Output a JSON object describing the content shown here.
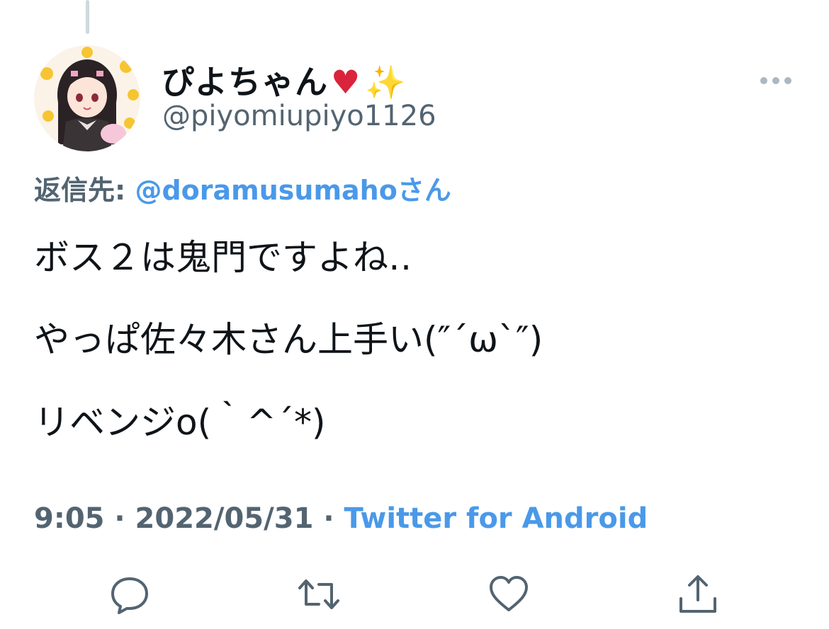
{
  "tweet": {
    "display_name": "ぴよちゃん",
    "name_emoji_heart": "♥",
    "name_emoji_sparkles": "✨",
    "handle": "@piyomiupiyo1126",
    "reply_prefix": "返信先: ",
    "reply_to": "@doramusumahoさん",
    "text_lines": [
      "ボス２は鬼門ですよね‥",
      "やっぱ佐々木さん上手い(″´ω`″)",
      "リベンジo(｀^´*)"
    ],
    "time": "9:05 · 2022/05/31 · ",
    "source": "Twitter for Android"
  },
  "icons": {
    "more": "more-horizontal-icon",
    "reply": "reply-icon",
    "retweet": "retweet-icon",
    "like": "heart-icon",
    "share": "share-icon"
  },
  "colors": {
    "link": "#4a99e9",
    "secondary_text": "#536471",
    "primary_text": "#0f1419",
    "icon_gray": "#536471"
  }
}
